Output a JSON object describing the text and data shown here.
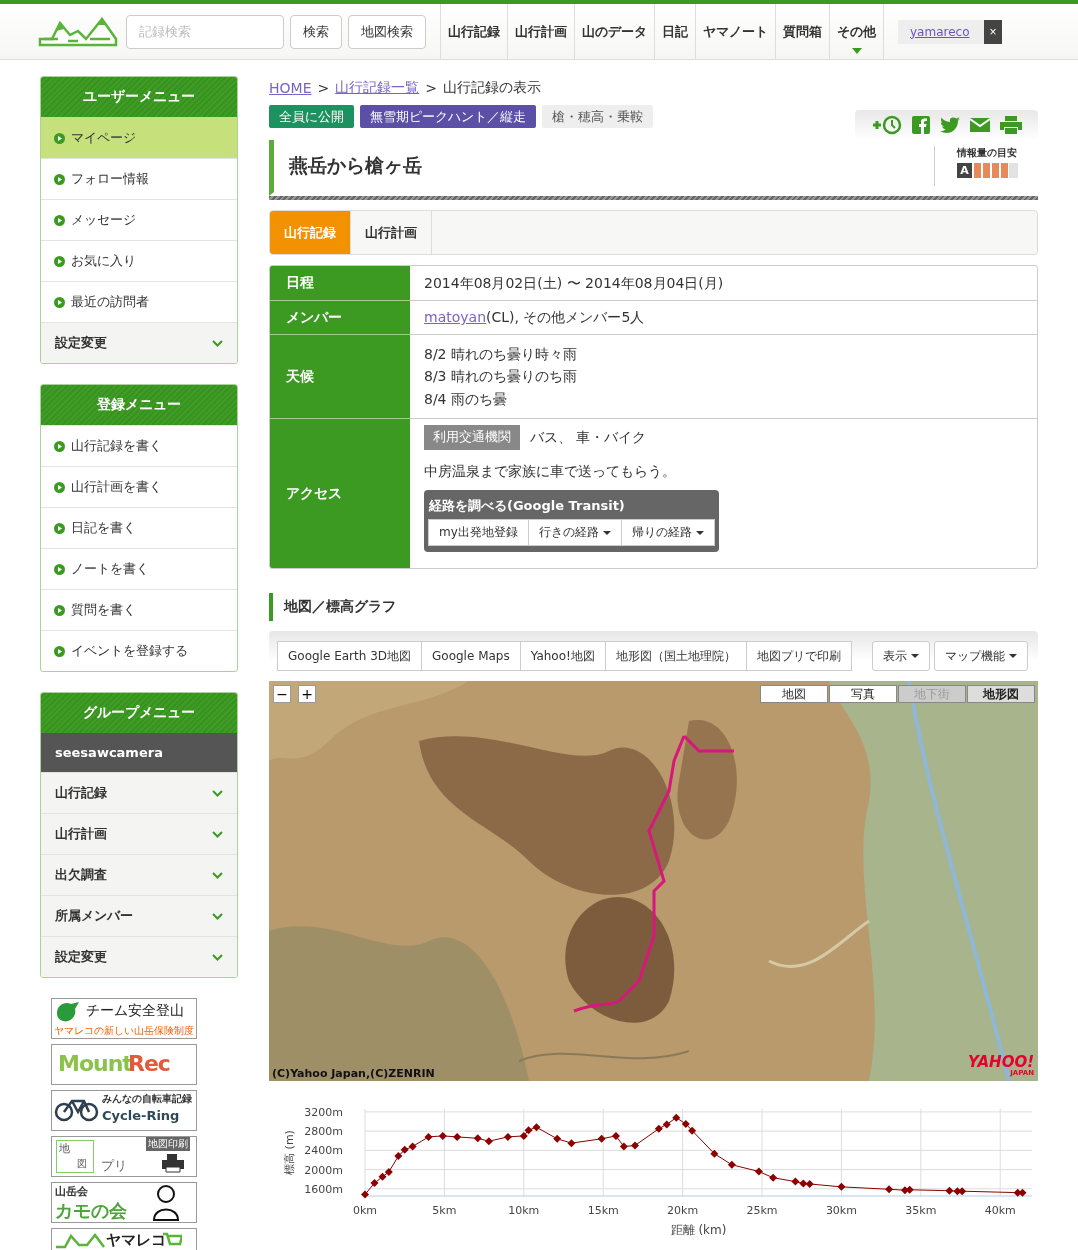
{
  "header": {
    "search": {
      "placeholder": "記録検索"
    },
    "buttons": [
      "検索",
      "地図検索"
    ],
    "nav": [
      {
        "label": "山行記録",
        "has_menu": false
      },
      {
        "label": "山行計画",
        "has_menu": false
      },
      {
        "label": "山のデータ",
        "has_menu": false
      },
      {
        "label": "日記",
        "has_menu": false
      },
      {
        "label": "ヤマノート",
        "has_menu": false
      },
      {
        "label": "質問箱",
        "has_menu": false
      },
      {
        "label": "その他",
        "has_menu": true
      }
    ],
    "user": {
      "name": "yamareco",
      "close": "×"
    }
  },
  "user_menu": {
    "title": "ユーザーメニュー",
    "items": [
      {
        "label": "マイページ",
        "kind": "link",
        "selected": true
      },
      {
        "label": "フォロー情報",
        "kind": "link",
        "selected": false
      },
      {
        "label": "メッセージ",
        "kind": "link",
        "selected": false
      },
      {
        "label": "お気に入り",
        "kind": "link",
        "selected": false
      },
      {
        "label": "最近の訪問者",
        "kind": "link",
        "selected": false
      },
      {
        "label": "設定変更",
        "kind": "expand",
        "selected": false
      }
    ]
  },
  "register_menu": {
    "title": "登録メニュー",
    "items": [
      {
        "label": "山行記録を書く",
        "kind": "link",
        "selected": false
      },
      {
        "label": "山行計画を書く",
        "kind": "link",
        "selected": false
      },
      {
        "label": "日記を書く",
        "kind": "link",
        "selected": false
      },
      {
        "label": "ノートを書く",
        "kind": "link",
        "selected": false
      },
      {
        "label": "質問を書く",
        "kind": "link",
        "selected": false
      },
      {
        "label": "イベントを登録する",
        "kind": "link",
        "selected": false
      }
    ]
  },
  "group_menu": {
    "title": "グループメニュー",
    "group": "seesawcamera",
    "items": [
      {
        "label": "山行記録",
        "kind": "expand",
        "selected": false
      },
      {
        "label": "山行計画",
        "kind": "expand",
        "selected": false
      },
      {
        "label": "出欠調査",
        "kind": "expand",
        "selected": false
      },
      {
        "label": "所属メンバー",
        "kind": "expand",
        "selected": false
      },
      {
        "label": "設定変更",
        "kind": "expand",
        "selected": false
      }
    ]
  },
  "banners": [
    {
      "kind": "insurance",
      "texts": [
        "チーム安全登山",
        "ヤマレコの新しい山岳保険制度"
      ]
    },
    {
      "kind": "mountrec",
      "texts": [
        "Mount",
        "Rec"
      ]
    },
    {
      "kind": "cyclering",
      "texts": [
        "みんなの自転車記録",
        "Cycle-Ring"
      ]
    },
    {
      "kind": "mapprint",
      "texts": [
        "地",
        "図",
        "プリ",
        "地図印刷"
      ]
    },
    {
      "kind": "club",
      "texts": [
        "山岳会",
        "カモの会"
      ]
    },
    {
      "kind": "shop",
      "texts": [
        "ヤマレコ"
      ]
    }
  ],
  "breadcrumb": {
    "separator": ">",
    "items": [
      {
        "label": "HOME",
        "link": true
      },
      {
        "label": "山行記録一覧",
        "link": true
      },
      {
        "label": "山行記録の表示",
        "link": false
      }
    ]
  },
  "tags": [
    {
      "label": "全員に公開",
      "color": "#1d9160"
    },
    {
      "label": "無雪期ピークハント／縦走",
      "color": "#5c4fa6"
    },
    {
      "label": "槍・穂高・乗鞍",
      "color": "#eeeeee"
    }
  ],
  "title": "燕岳から槍ヶ岳",
  "info_level": {
    "label": "情報量の目安",
    "grade": "A",
    "level": 0.8
  },
  "tabs": [
    {
      "label": "山行記録",
      "selected": true
    },
    {
      "label": "山行計画",
      "selected": false
    }
  ],
  "details": [
    {
      "kind": "text",
      "label": "日程",
      "value": "2014年08月02日(土) 〜 2014年08月04日(月)"
    },
    {
      "kind": "member",
      "label": "メンバー",
      "link": "matoyan",
      "text": "(CL), その他メンバー5人"
    },
    {
      "kind": "lines",
      "label": "天候",
      "lines": [
        "8/2 晴れのち曇り時々雨",
        "8/3 晴れのち曇りのち雨",
        "8/4 雨のち曇"
      ]
    },
    {
      "kind": "access",
      "label": "アクセス",
      "transport_tag": "利用交通機関",
      "transport": "バス、 車・バイク",
      "note": "中房温泉まで家族に車で送ってもらう。",
      "route": {
        "title": "経路を調べる(Google Transit)",
        "buttons": [
          {
            "label": "my出発地登録",
            "dropdown": false
          },
          {
            "label": "行きの経路",
            "dropdown": true
          },
          {
            "label": "帰りの経路",
            "dropdown": true
          }
        ]
      }
    }
  ],
  "map_section": {
    "title": "地図／標高グラフ",
    "tools": [
      "Google Earth 3D地図",
      "Google Maps",
      "Yahoo!地図",
      "地形図（国土地理院）",
      "地図プリで印刷"
    ],
    "menus": [
      "表示",
      "マップ機能"
    ],
    "map": {
      "kind": "picture",
      "zoom_out": "−",
      "zoom_in": "+",
      "layers": [
        {
          "label": "地図",
          "selected": false,
          "disabled": false
        },
        {
          "label": "写真",
          "selected": false,
          "disabled": false
        },
        {
          "label": "地下街",
          "selected": false,
          "disabled": true
        },
        {
          "label": "地形図",
          "selected": true,
          "disabled": false
        }
      ],
      "credit": "(C)Yahoo Japan,(C)ZENRIN",
      "brand": "YAHOO!",
      "brand_sub": "JAPAN"
    },
    "chart_data": {
      "type": "line",
      "xlabel": "距離 (km)",
      "ylabel": "標高 (m)",
      "x": [
        0,
        0.6,
        1.1,
        1.5,
        2.1,
        2.5,
        3,
        4,
        4.9,
        5.8,
        7.1,
        7.8,
        9,
        10,
        10.3,
        10.8,
        12.1,
        13,
        14.9,
        15.8,
        16.3,
        17,
        18.5,
        19,
        19.6,
        20.2,
        20.6,
        22,
        23.1,
        24.8,
        25.7,
        27.1,
        27.6,
        28,
        30,
        33,
        34,
        34.3,
        36.8,
        37.3,
        37.6,
        41.1,
        41.4
      ],
      "grid": true,
      "series": [
        {
          "color": "#8b0000",
          "marker": "diamond",
          "values": [
            1480,
            1720,
            1850,
            1950,
            2280,
            2410,
            2480,
            2680,
            2700,
            2680,
            2650,
            2590,
            2680,
            2700,
            2820,
            2880,
            2640,
            2550,
            2640,
            2700,
            2480,
            2500,
            2850,
            2940,
            3080,
            2950,
            2810,
            2330,
            2100,
            1960,
            1830,
            1750,
            1710,
            1700,
            1640,
            1590,
            1570,
            1580,
            1560,
            1550,
            1550,
            1520,
            1520
          ]
        }
      ],
      "xlim": [
        0,
        42
      ],
      "ylim": [
        1450,
        3260
      ],
      "xticks": [
        {
          "value": 0,
          "label": "0km"
        },
        {
          "value": 5,
          "label": "5km"
        },
        {
          "value": 10,
          "label": "10km"
        },
        {
          "value": 15,
          "label": "15km"
        },
        {
          "value": 20,
          "label": "20km"
        },
        {
          "value": 25,
          "label": "25km"
        },
        {
          "value": 30,
          "label": "30km"
        },
        {
          "value": 35,
          "label": "35km"
        },
        {
          "value": 40,
          "label": "40km"
        }
      ],
      "yticks": [
        {
          "value": 1600,
          "label": "1600m"
        },
        {
          "value": 2000,
          "label": "2000m"
        },
        {
          "value": 2400,
          "label": "2400m"
        },
        {
          "value": 2800,
          "label": "2800m"
        },
        {
          "value": 3200,
          "label": "3200m"
        }
      ]
    }
  }
}
